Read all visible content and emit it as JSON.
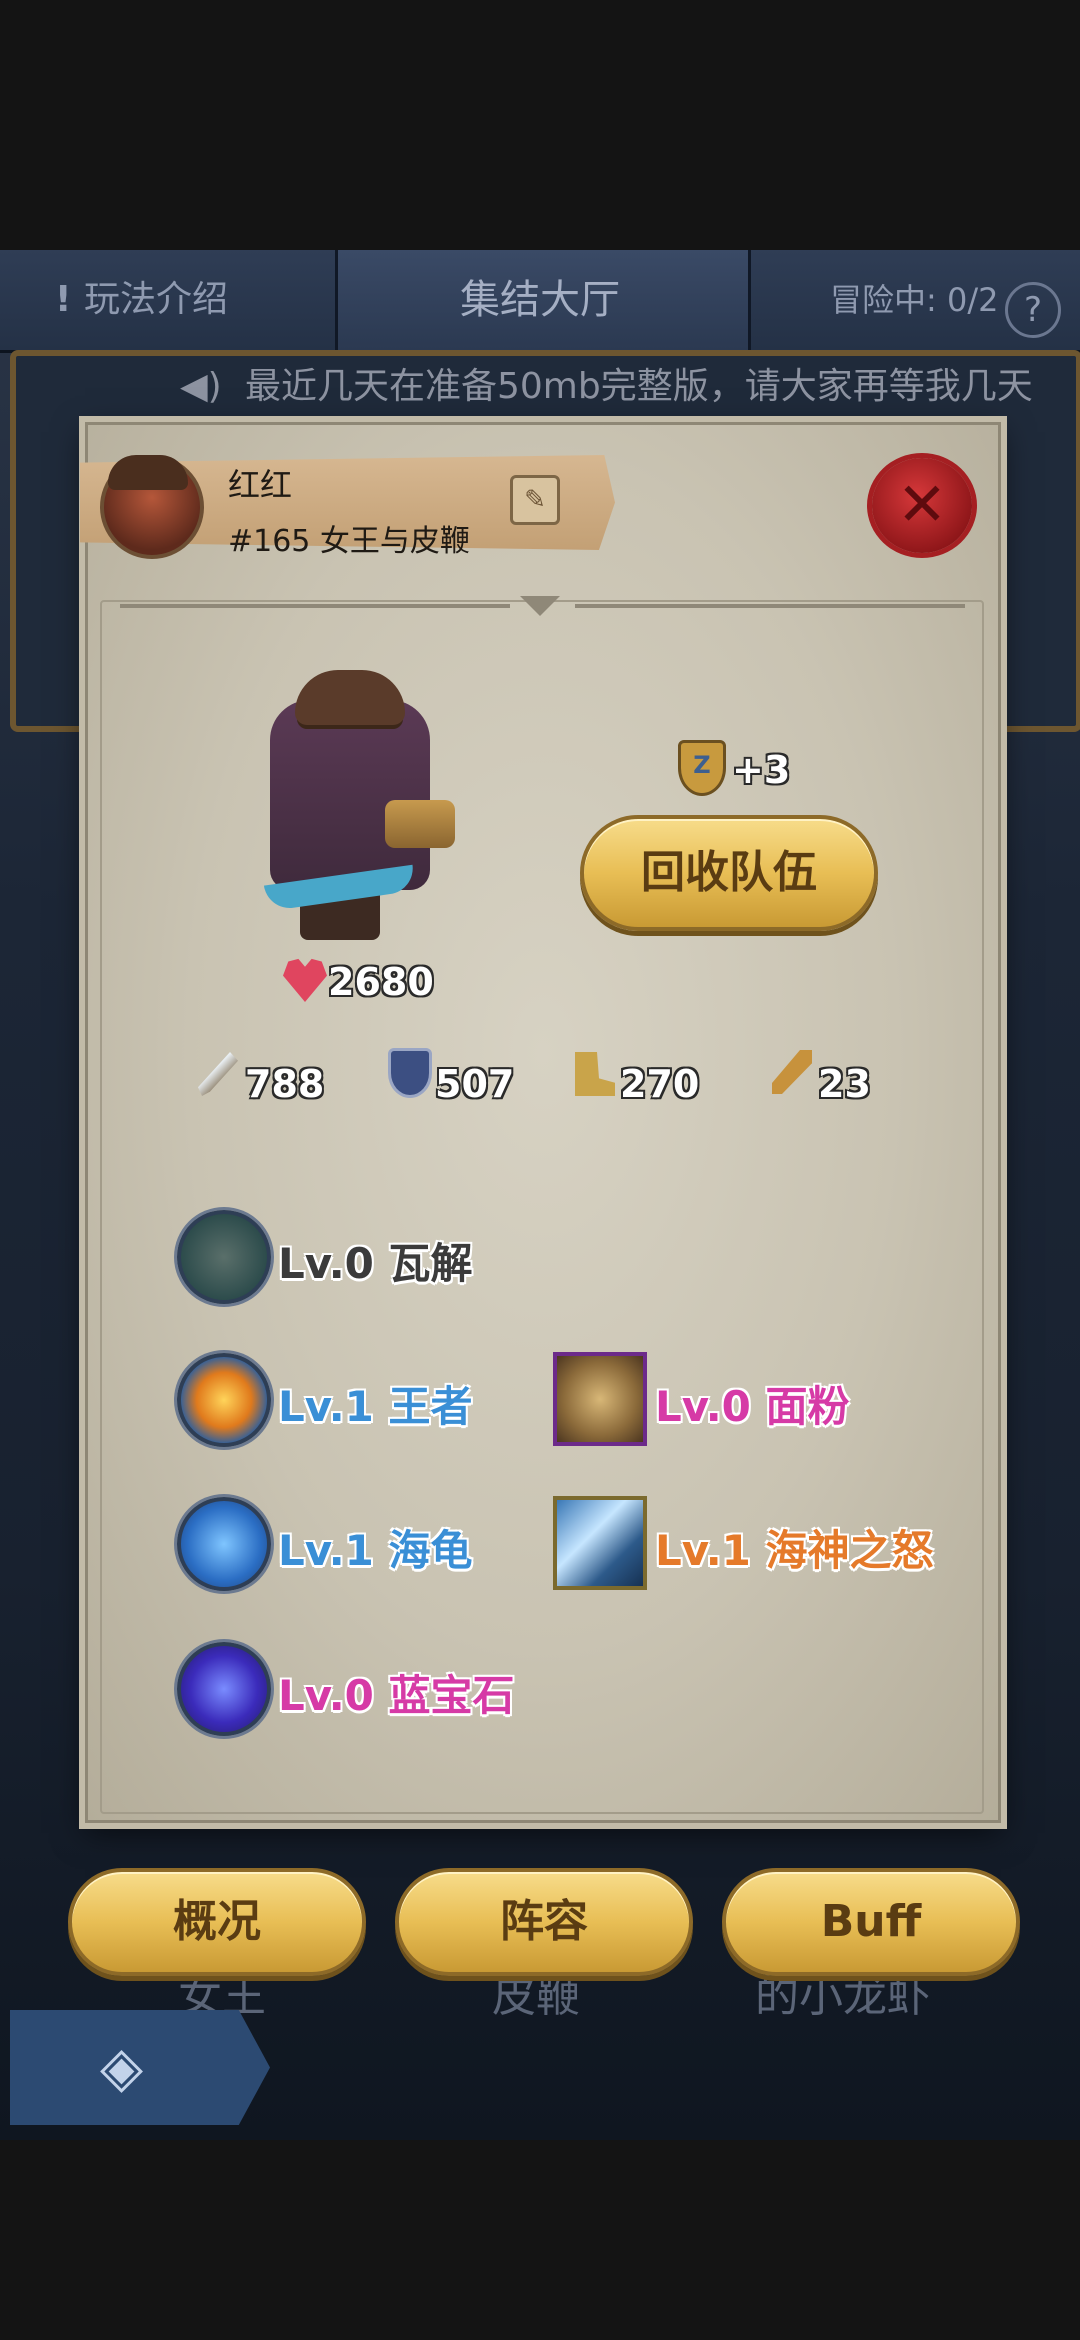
{
  "top": {
    "intro_label": "玩法介绍",
    "title": "集结大厅",
    "adventure_status": "冒险中: 0/2",
    "help_glyph": "?"
  },
  "marquee": {
    "text": "最近几天在准备50mb完整版，请大家再等我几天"
  },
  "background_labels": [
    "女王",
    "皮鞭",
    "的小龙虾"
  ],
  "modal": {
    "player_name": "红红",
    "team_name": "#165 女王与皮鞭",
    "health": "2680",
    "badge_plus": "+3",
    "badge_glyph": "Z",
    "recycle_label": "回收队伍",
    "stats": {
      "attack": "788",
      "defense": "507",
      "speed": "270",
      "magic": "23"
    },
    "skills": [
      {
        "level": "Lv.0",
        "name": "瓦解",
        "icon": "shield-skill-icon",
        "color": "#3b3b3b"
      },
      {
        "level": "Lv.1",
        "name": "王者",
        "icon": "crown-skill-icon",
        "color": "#3a8fd6"
      },
      {
        "level": "Lv.1",
        "name": "海龟",
        "icon": "turtle-skill-icon",
        "color": "#3a8fd6"
      },
      {
        "level": "Lv.0",
        "name": "蓝宝石",
        "icon": "sapphire-skill-icon",
        "color": "#d63aa6"
      }
    ],
    "items": [
      {
        "level": "Lv.0",
        "name": "面粉",
        "icon": "flour-sack-icon",
        "color": "#d63aa6"
      },
      {
        "level": "Lv.1",
        "name": "海神之怒",
        "icon": "poseidon-icon",
        "color": "#e57a2a"
      }
    ]
  },
  "tabs": {
    "overview": "概况",
    "lineup": "阵容",
    "buff": "Buff"
  }
}
